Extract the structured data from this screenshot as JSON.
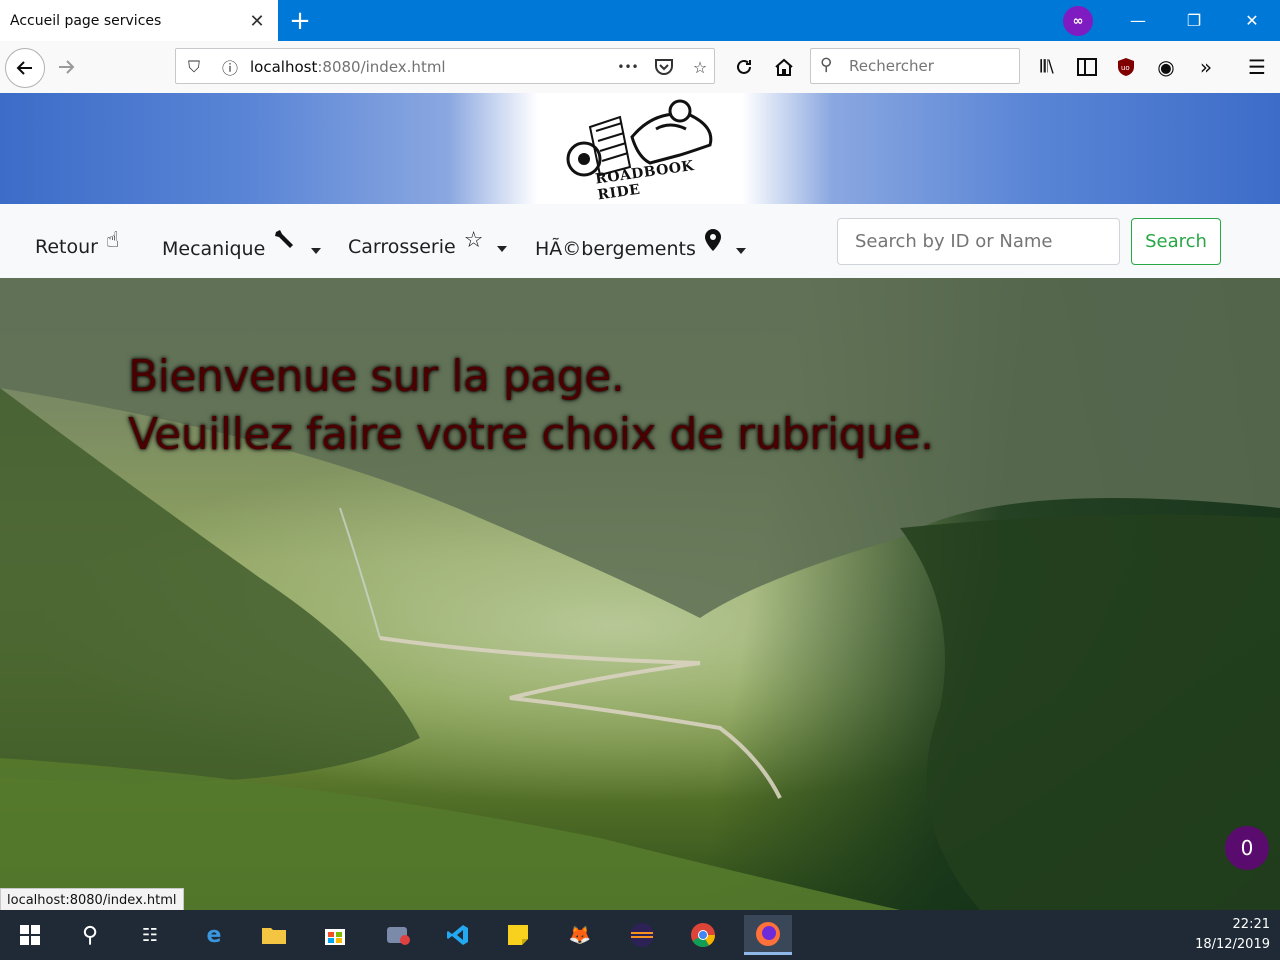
{
  "browser": {
    "tab_title": "Accueil page services",
    "tab_close": "✕",
    "new_tab": "+",
    "url_host": "localhost",
    "url_rest": ":8080/index.html",
    "search_placeholder": "Rechercher",
    "more_dots": "•••"
  },
  "page": {
    "brand": "ROADBOOK RIDE",
    "menu": [
      {
        "label": "Retour"
      },
      {
        "label": "Mecanique"
      },
      {
        "label": "Carrosserie"
      },
      {
        "label": "HÃ©bergements"
      }
    ],
    "search_placeholder": "Search by ID or Name",
    "search_button": "Search",
    "welcome_line1": "Bienvenue sur la page.",
    "welcome_line2": "Veuillez faire votre choix de rubrique.",
    "badge_count": "0",
    "status_url": "localhost:8080/index.html"
  },
  "taskbar": {
    "time": "22:21",
    "date": "18/12/2019"
  },
  "colors": {
    "titlebar": "#0078d7",
    "search_button": "#28a745",
    "welcome_text": "#4a0000",
    "badge": "#5a0b6e",
    "taskbar": "#1f2a36"
  }
}
